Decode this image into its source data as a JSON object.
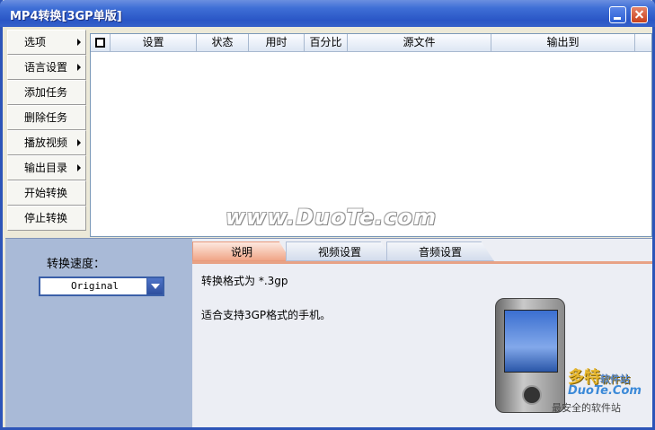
{
  "window": {
    "title": "MP4转换[3GP单版]"
  },
  "sidebar": {
    "items": [
      {
        "label": "选项",
        "has_submenu": true
      },
      {
        "label": "语言设置",
        "has_submenu": true
      },
      {
        "label": "添加任务",
        "has_submenu": false
      },
      {
        "label": "删除任务",
        "has_submenu": false
      },
      {
        "label": "播放视频",
        "has_submenu": true
      },
      {
        "label": "输出目录",
        "has_submenu": true
      },
      {
        "label": "开始转换",
        "has_submenu": false
      },
      {
        "label": "停止转换",
        "has_submenu": false
      }
    ]
  },
  "task_table": {
    "columns": [
      "设置",
      "状态",
      "用时",
      "百分比",
      "源文件",
      "输出到"
    ],
    "rows": []
  },
  "watermark": "www.DuoTe.com",
  "speed": {
    "label": "转换速度：",
    "selected": "Original"
  },
  "tabs": [
    {
      "label": "说明",
      "active": true
    },
    {
      "label": "视频设置",
      "active": false
    },
    {
      "label": "音频设置",
      "active": false
    }
  ],
  "description": {
    "format_line": "转换格式为 *.3gp",
    "support_line": "适合支持3GP格式的手机。"
  },
  "branding": {
    "name": "多特",
    "suffix": "软件站",
    "site": "DuoTe.Com",
    "tagline": "最安全的软件站"
  }
}
